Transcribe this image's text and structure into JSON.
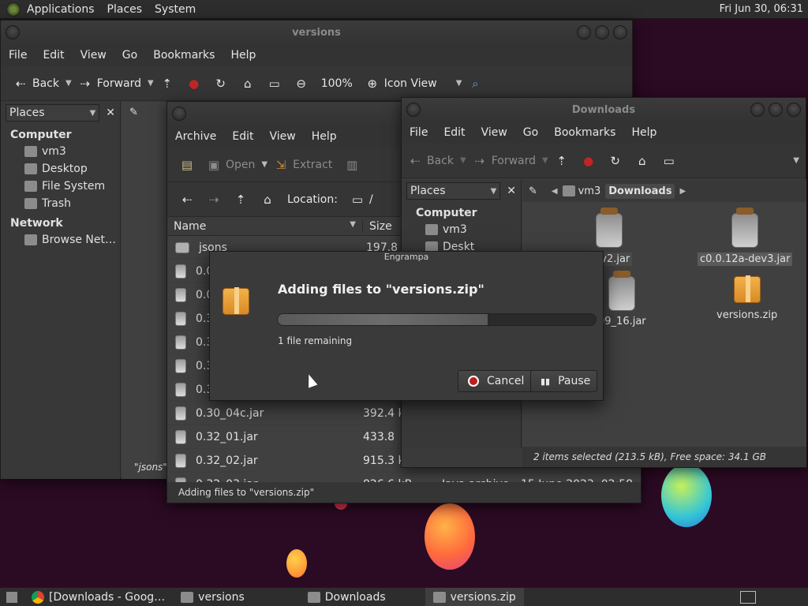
{
  "topbar": {
    "menus": [
      "Applications",
      "Places",
      "System"
    ],
    "clock": "Fri Jun 30, 06:31"
  },
  "versions_window": {
    "title": "versions",
    "menus": [
      "File",
      "Edit",
      "View",
      "Go",
      "Bookmarks",
      "Help"
    ],
    "toolbar": {
      "back": "Back",
      "forward": "Forward",
      "zoom": "100%",
      "view_mode": "Icon View"
    },
    "sidebar": {
      "selector": "Places",
      "group_computer": "Computer",
      "items": [
        "vm3",
        "Desktop",
        "File System",
        "Trash"
      ],
      "group_network": "Network",
      "network_items": [
        "Browse Net…"
      ]
    },
    "status_fragment": "\"jsons\" s"
  },
  "engrampa_window": {
    "title_fragment": "versi",
    "menus": [
      "Archive",
      "Edit",
      "View",
      "Help"
    ],
    "toolbar": {
      "open": "Open",
      "extract": "Extract"
    },
    "location_label": "Location:",
    "location_fragment": "/",
    "columns": {
      "name": "Name",
      "size": "Size"
    },
    "rows": [
      {
        "name": "jsons",
        "size": "197.8 k"
      },
      {
        "name": "0.0",
        "size": ""
      },
      {
        "name": "0.0",
        "size": ""
      },
      {
        "name": "0.3",
        "size": ""
      },
      {
        "name": "0.3",
        "size": ""
      },
      {
        "name": "0.3",
        "size": ""
      },
      {
        "name": "0.3",
        "size": ""
      },
      {
        "name": "0.30_04c.jar",
        "size": "392.4 k"
      },
      {
        "name": "0.32_01.jar",
        "size": "433.8"
      },
      {
        "name": "0.32_02.jar",
        "size": "915.3 k"
      },
      {
        "name": "0.32_03.jar",
        "size": "826.6 kB",
        "type": "Java archive",
        "date": "15 June 2023, 02:58"
      }
    ],
    "status": "Adding files to \"versions.zip\""
  },
  "downloads_window": {
    "title": "Downloads",
    "menus": [
      "File",
      "Edit",
      "View",
      "Go",
      "Bookmarks",
      "Help"
    ],
    "toolbar": {
      "back": "Back",
      "forward": "Forward"
    },
    "sidebar": {
      "selector": "Places",
      "group_computer": "Computer",
      "items": [
        "vm3",
        "Deskt"
      ]
    },
    "breadcrumb": [
      "vm3",
      "Downloads"
    ],
    "files": [
      {
        "name": "dev2.jar",
        "kind": "jar"
      },
      {
        "name": "c0.0.12a-dev3.jar",
        "kind": "jar",
        "selected": true
      },
      {
        "name": "09_16.jar",
        "kind": "jar"
      },
      {
        "name": "versions.zip",
        "kind": "zip"
      }
    ],
    "status": "2 items selected (213.5 kB), Free space: 34.1 GB"
  },
  "dialog": {
    "title": "Engrampa",
    "heading": "Adding files to \"versions.zip\"",
    "remaining": "1 file remaining",
    "progress": 0.66,
    "cancel": "Cancel",
    "pause": "Pause"
  },
  "taskbar": {
    "items": [
      {
        "label": "[Downloads - Goog…",
        "icon": "chrome-icon"
      },
      {
        "label": "versions",
        "icon": "folder-icon"
      },
      {
        "label": "Downloads",
        "icon": "folder-icon"
      },
      {
        "label": "versions.zip",
        "icon": "archive-icon",
        "active": true
      }
    ]
  }
}
